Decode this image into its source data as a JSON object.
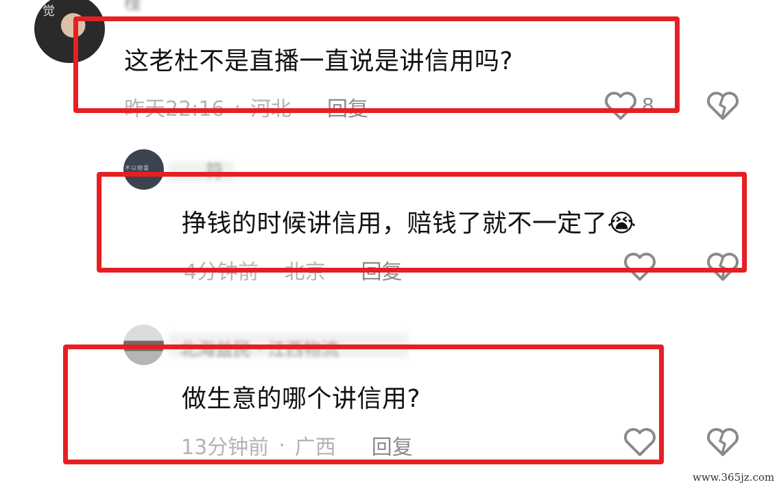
{
  "comments": [
    {
      "username": "槿",
      "text": "这老杜不是直播一直说是讲信用吗?",
      "time": "昨天22:16",
      "location": "河北",
      "reply_label": "回复",
      "like_count": "8"
    },
    {
      "username": "符",
      "avatar_text": "不以物喜",
      "text": "挣钱的时候讲信用，赔钱了就不一定了😭",
      "time": "4分钟前",
      "location": "北京",
      "reply_label": "回复",
      "like_count": ""
    },
    {
      "username": "北海益民 · 江西物流",
      "text": "做生意的哪个讲信用?",
      "time": "13分钟前",
      "location": "广西",
      "reply_label": "回复",
      "like_count": ""
    }
  ],
  "separator": "·",
  "avatar1_text": "觉",
  "icons": {
    "like": "heart-outline-icon",
    "dislike": "broken-heart-icon"
  },
  "colors": {
    "highlight_box": "#e52024",
    "meta_text": "#b3b3b3",
    "icon_stroke": "#8a8a8a"
  },
  "watermark": "www.365jz.com"
}
